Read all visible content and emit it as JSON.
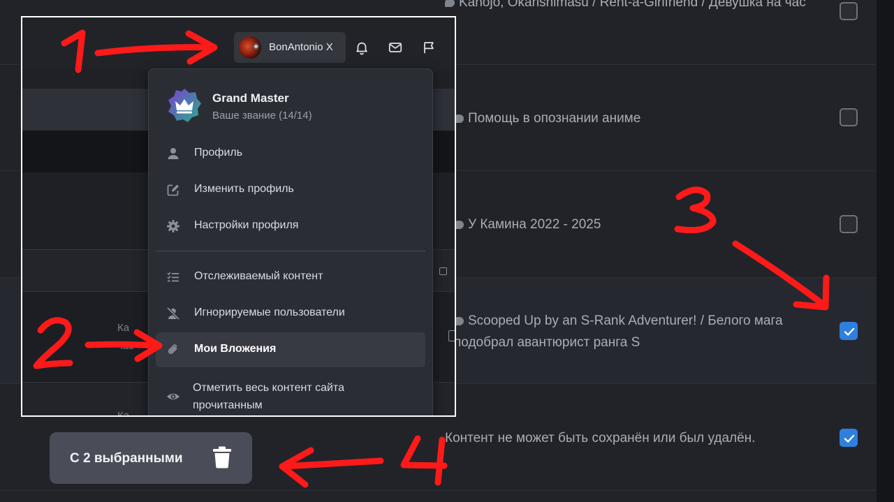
{
  "background": {
    "rows": [
      {
        "title": "Kanojo, Okarishimasu / Rent-a-Girlfriend / Девушка на час",
        "checked": false
      },
      {
        "title": "Помощь в опознании аниме",
        "checked": false
      },
      {
        "title": "У Камина 2022 - 2025",
        "checked": false
      },
      {
        "title": "Scooped Up by an S-Rank Adventurer! / Белого мага подобрал авантюрист ранга S",
        "checked": true
      },
      {
        "title": "Контент не может быть сохранён или был удалён.",
        "checked": true
      }
    ]
  },
  "header": {
    "username": "BonAntonio X",
    "icons": [
      "bell-icon",
      "mail-icon",
      "flag-icon"
    ]
  },
  "ghost": {
    "snippet_a": "Ка",
    "snippet_b": "час",
    "snippet_c": "Ка"
  },
  "dropdown": {
    "rank_title": "Grand Master",
    "rank_subtitle": "Ваше звание (14/14)",
    "items": [
      {
        "label": "Профиль",
        "icon": "user-icon"
      },
      {
        "label": "Изменить профиль",
        "icon": "edit-icon"
      },
      {
        "label": "Настройки профиля",
        "icon": "gear-icon"
      },
      {
        "label": "Отслеживаемый контент",
        "icon": "checklist-icon"
      },
      {
        "label": "Игнорируемые пользователи",
        "icon": "user-slash-icon"
      },
      {
        "label": "Мои Вложения",
        "icon": "paperclip-icon"
      },
      {
        "label": "Отметить весь контент сайта прочитанным",
        "icon": "eye-icon"
      }
    ]
  },
  "action_bar": {
    "label": "С 2 выбранными",
    "icon": "trash-icon"
  },
  "annotations": [
    "1",
    "2",
    "3",
    "4"
  ],
  "colors": {
    "accent": "#2f7fde",
    "annotation": "#ff1a1a",
    "panel": "#212329"
  }
}
